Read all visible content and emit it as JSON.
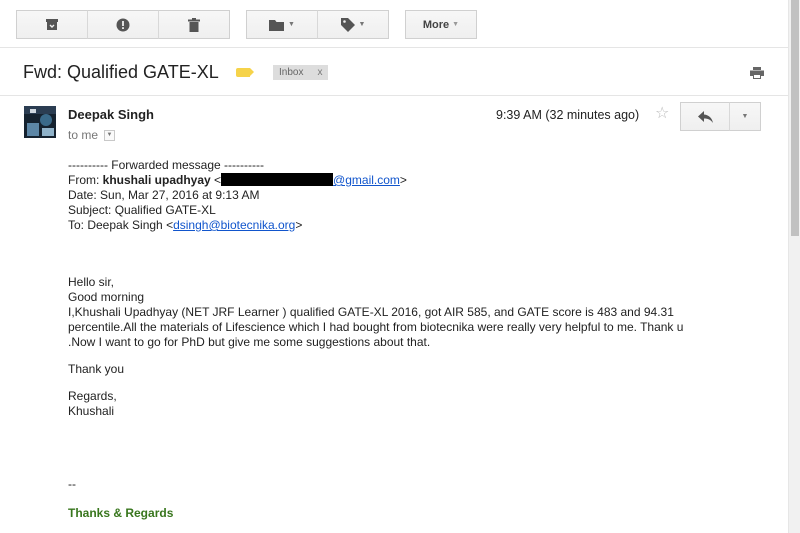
{
  "toolbar": {
    "archive_icon": "archive-icon",
    "spam_icon": "report-spam-icon",
    "delete_icon": "trash-icon",
    "move_icon": "folder-icon",
    "labels_icon": "tag-icon",
    "more_label": "More"
  },
  "message": {
    "subject": "Fwd: Qualified GATE-XL",
    "label_color": "#f6d34a",
    "inbox_tag": "Inbox",
    "inbox_tag_close": "x",
    "sender_name": "Deepak Singh",
    "to_me": "to me",
    "time": "9:39 AM (32 minutes ago)",
    "forward_header": "---------- Forwarded message ----------",
    "from_prefix": "From: ",
    "from_name": "khushali upadhyay",
    "from_open": " <",
    "from_email_visible": "@gmail.com",
    "from_close": ">",
    "date_line": "Date: Sun, Mar 27, 2016 at 9:13 AM",
    "subject_line": "Subject: Qualified GATE-XL",
    "to_prefix": "To: Deepak Singh <",
    "to_email": "dsingh@biotecnika.org",
    "to_close": ">",
    "greeting1": "Hello sir,",
    "greeting2": "Good morning",
    "paragraph_line1": "I,Khushali Upadhyay (NET JRF Learner ) qualified GATE-XL 2016, got AIR 585, and GATE score is 483 and 94.31",
    "paragraph_line2": "percentile.All the materials of Lifescience which I had bought from biotecnika were really very helpful to me. Thank u",
    "paragraph_line3": ".Now I want to go for PhD but give me some suggestions about that.",
    "thank_you": "Thank you",
    "regards": "Regards,",
    "sign_name": "Khushali",
    "sig_dash": "--",
    "thanks_regards": "Thanks & Regards"
  },
  "colors": {
    "link": "#1155cc",
    "signature_green": "#38761d"
  }
}
